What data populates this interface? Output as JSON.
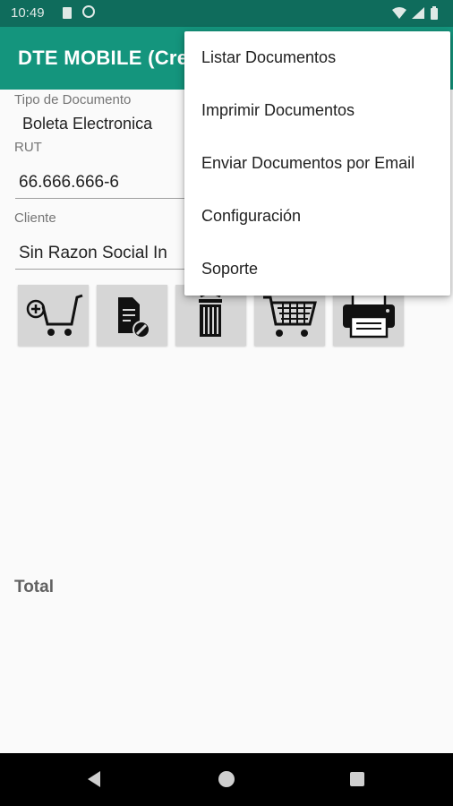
{
  "status_bar": {
    "time": "10:49",
    "icons": [
      "sim-card-icon",
      "at-sign-icon",
      "wifi-icon",
      "cell-signal-icon",
      "battery-icon"
    ]
  },
  "app_bar": {
    "title": "DTE MOBILE (Cre",
    "color": "#14957d"
  },
  "form": {
    "tipo_documento": {
      "label": "Tipo de Documento",
      "value": "Boleta Electronica"
    },
    "rut": {
      "label": "RUT",
      "value": "66.666.666-6"
    },
    "cliente": {
      "label": "Cliente",
      "value": "Sin Razon Social In"
    }
  },
  "toolbar": {
    "buttons": [
      "add-to-cart-icon",
      "document-edit-icon",
      "trash-icon",
      "cart-icon",
      "printer-icon"
    ]
  },
  "total": {
    "label": "Total"
  },
  "menu": {
    "items": [
      "Listar Documentos",
      "Imprimir Documentos",
      "Enviar Documentos por Email",
      "Configuración",
      "Soporte"
    ]
  },
  "nav_bar": {
    "icons": [
      "back-icon",
      "home-icon",
      "recents-icon"
    ]
  }
}
